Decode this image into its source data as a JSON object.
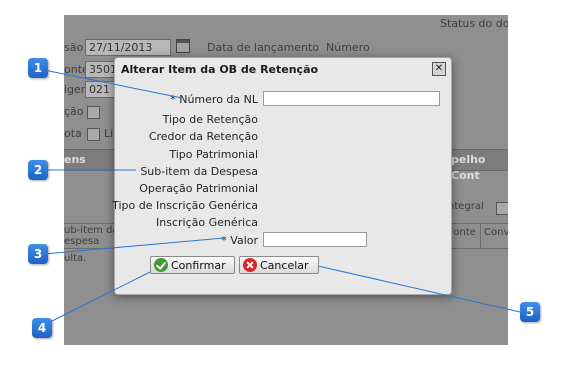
{
  "background": {
    "status_label": "Status do doc",
    "emissao_label": "são",
    "emissao_value": "27/11/2013",
    "lancamento_label": "Data de lançamento",
    "numero_label": "Número",
    "fonte_label": "onte",
    "fonte_value": "3501",
    "origem_label": "igem",
    "origem_value": "021 -",
    "situacao_label": "ção",
    "nota_label": "ota",
    "nota_check_label": "Lib",
    "tab_itens": "ens",
    "tab_espelho": "pelho Cont",
    "integral_label": "ntegral",
    "grid_subitem": "ub-item da",
    "grid_despesa": "espesa",
    "grid_fonte": "Fonte",
    "grid_conv": "Conv",
    "below_text": "ulta."
  },
  "dialog": {
    "title": "Alterar Item da OB de Retenção",
    "close_symbol": "✕",
    "fields": {
      "numero_nl_label": "* Número da NL",
      "numero_nl_value": "",
      "tipo_retencao_label": "Tipo de Retenção",
      "credor_retencao_label": "Credor da Retenção",
      "tipo_patrimonial_label": "Tipo Patrimonial",
      "subitem_despesa_label": "Sub-item da Despesa",
      "operacao_patrimonial_label": "Operação Patrimonial",
      "tipo_inscricao_label": "Tipo de Inscrição Genérica",
      "inscricao_generica_label": "Inscrição Genérica",
      "valor_label": "* Valor",
      "valor_value": ""
    },
    "buttons": {
      "confirm_label": "Confirmar",
      "cancel_label": "Cancelar"
    }
  },
  "callouts": [
    "1",
    "2",
    "3",
    "4",
    "5"
  ],
  "colors": {
    "callout": "#2a74d6",
    "overlay_gray": "#8f8f8f",
    "dialog_bg": "#e8e8e8",
    "confirm_icon": "#3f9a2f",
    "cancel_icon": "#d9262a"
  }
}
